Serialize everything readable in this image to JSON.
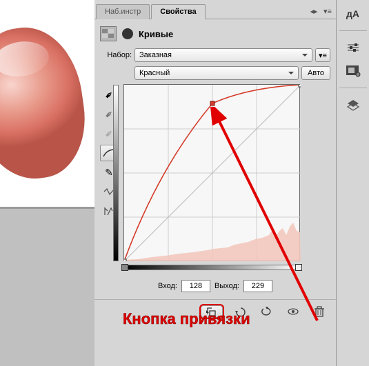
{
  "tabs": {
    "tools": "Наб.инстр",
    "properties": "Свойства"
  },
  "panel": {
    "title": "Кривые"
  },
  "preset": {
    "label": "Набор:",
    "value": "Заказная"
  },
  "channel": {
    "value": "Красный",
    "auto_label": "Авто"
  },
  "io": {
    "input_label": "Вход:",
    "input_value": "128",
    "output_label": "Выход:",
    "output_value": "229"
  },
  "annotation": "Кнопка привязки",
  "chart_data": {
    "type": "line",
    "title": "Tone curve (Red channel)",
    "xlabel": "Input",
    "ylabel": "Output",
    "xlim": [
      0,
      255
    ],
    "ylim": [
      0,
      255
    ],
    "series": [
      {
        "name": "curve",
        "color": "#d43b2a",
        "x": [
          0,
          32,
          64,
          96,
          128,
          160,
          192,
          224,
          255
        ],
        "y": [
          0,
          95,
          160,
          205,
          229,
          244,
          251,
          254,
          255
        ]
      },
      {
        "name": "baseline",
        "color": "#bbbbbb",
        "x": [
          0,
          255
        ],
        "y": [
          0,
          255
        ]
      }
    ],
    "points": [
      {
        "x": 0,
        "y": 0
      },
      {
        "x": 128,
        "y": 229
      },
      {
        "x": 255,
        "y": 255
      }
    ]
  }
}
